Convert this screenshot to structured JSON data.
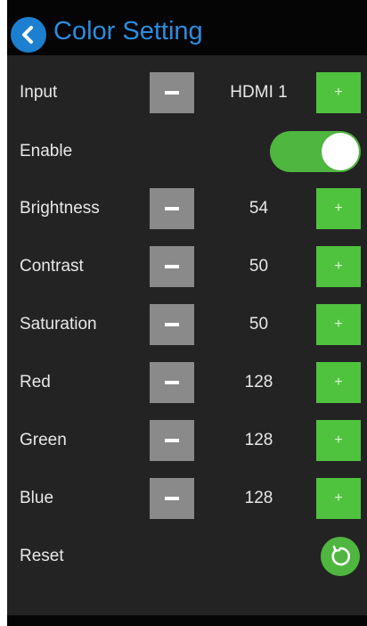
{
  "header": {
    "title": "Color Setting",
    "back_icon": "chevron-left-icon",
    "accent_color": "#2b8de0"
  },
  "colors": {
    "background": "#232323",
    "minus_button": "#8a8a8a",
    "plus_button": "#4fc23e",
    "toggle_on": "#4fb63f"
  },
  "rows": {
    "input": {
      "label": "Input",
      "value": "HDMI 1",
      "minus": "minus-icon",
      "plus": "+"
    },
    "enable": {
      "label": "Enable",
      "state": "on"
    },
    "brightness": {
      "label": "Brightness",
      "value": "54",
      "plus": "+"
    },
    "contrast": {
      "label": "Contrast",
      "value": "50",
      "plus": "+"
    },
    "saturation": {
      "label": "Saturation",
      "value": "50",
      "plus": "+"
    },
    "red": {
      "label": "Red",
      "value": "128",
      "plus": "+"
    },
    "green": {
      "label": "Green",
      "value": "128",
      "plus": "+"
    },
    "blue": {
      "label": "Blue",
      "value": "128",
      "plus": "+"
    },
    "reset": {
      "label": "Reset",
      "icon": "reset-icon"
    }
  }
}
